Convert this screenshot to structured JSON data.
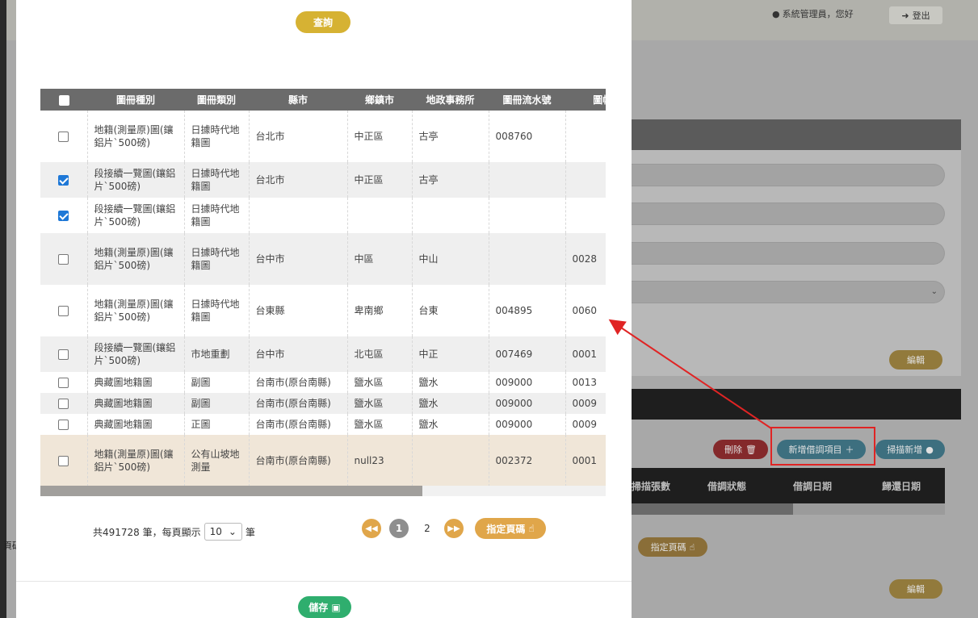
{
  "background": {
    "user_label": "系統管理員，您好",
    "logout_label": "登出",
    "edit_label": "編輯",
    "delete_label": "刪除",
    "add_borrow_label": "新增借調項目",
    "scan_add_label": "掃描新增",
    "table_headers": [
      "掃描張數",
      "借調狀態",
      "借調日期",
      "歸還日期"
    ],
    "goto_page_label": "指定頁碼",
    "left_text": "頁碼"
  },
  "modal": {
    "query_label": "查詢",
    "save_label": "儲存",
    "columns": [
      "",
      "圖冊種別",
      "圖冊類別",
      "縣市",
      "鄉鎮市",
      "地政事務所",
      "圖冊流水號",
      "圖幅(冊"
    ],
    "rows": [
      {
        "checked": false,
        "kind": "地籍(測量原)圖(鑲鋁片`500磅)",
        "category": "日據時代地籍圖",
        "county": "台北市",
        "town": "中正區",
        "office": "古亭",
        "serial": "008760",
        "sheet": ""
      },
      {
        "checked": true,
        "kind": "段接續一覽圖(鑲鋁片`500磅)",
        "category": "日據時代地籍圖",
        "county": "台北市",
        "town": "中正區",
        "office": "古亭",
        "serial": "",
        "sheet": ""
      },
      {
        "checked": true,
        "kind": "段接續一覽圖(鑲鋁片`500磅)",
        "category": "日據時代地籍圖",
        "county": "",
        "town": "",
        "office": "",
        "serial": "",
        "sheet": ""
      },
      {
        "checked": false,
        "kind": "地籍(測量原)圖(鑲鋁片`500磅)",
        "category": "日據時代地籍圖",
        "county": "台中市",
        "town": "中區",
        "office": "中山",
        "serial": "",
        "sheet": "0028"
      },
      {
        "checked": false,
        "kind": "地籍(測量原)圖(鑲鋁片`500磅)",
        "category": "日據時代地籍圖",
        "county": "台東縣",
        "town": "卑南鄉",
        "office": "台東",
        "serial": "004895",
        "sheet": "0060"
      },
      {
        "checked": false,
        "kind": "段接續一覽圖(鑲鋁片`500磅)",
        "category": "市地重劃",
        "county": "台中市",
        "town": "北屯區",
        "office": "中正",
        "serial": "007469",
        "sheet": "0001"
      },
      {
        "checked": false,
        "kind": "典藏圖地籍圖",
        "category": "副圖",
        "county": "台南市(原台南縣)",
        "town": "鹽水區",
        "office": "鹽水",
        "serial": "009000",
        "sheet": "0013"
      },
      {
        "checked": false,
        "kind": "典藏圖地籍圖",
        "category": "副圖",
        "county": "台南市(原台南縣)",
        "town": "鹽水區",
        "office": "鹽水",
        "serial": "009000",
        "sheet": "0009"
      },
      {
        "checked": false,
        "kind": "典藏圖地籍圖",
        "category": "正圖",
        "county": "台南市(原台南縣)",
        "town": "鹽水區",
        "office": "鹽水",
        "serial": "009000",
        "sheet": "0009"
      },
      {
        "checked": false,
        "kind": "地籍(測量原)圖(鑲鋁片`500磅)",
        "category": "公有山坡地測量",
        "county": "台南市(原台南縣)",
        "town": "null23",
        "office": "",
        "serial": "002372",
        "sheet": "0001"
      }
    ],
    "pager": {
      "total_prefix": "共491728 筆，每頁顯示",
      "page_size": "10",
      "total_suffix": "筆",
      "pages": [
        "1",
        "2"
      ],
      "goto_label": "指定頁碼"
    }
  },
  "colors": {
    "gold": "#d6b233",
    "orange": "#e0a64a",
    "save_green": "#2fae6e",
    "checkbox_blue": "#1e78d7",
    "header_gray": "#6b6b6b",
    "highlight_red": "#e02424"
  }
}
